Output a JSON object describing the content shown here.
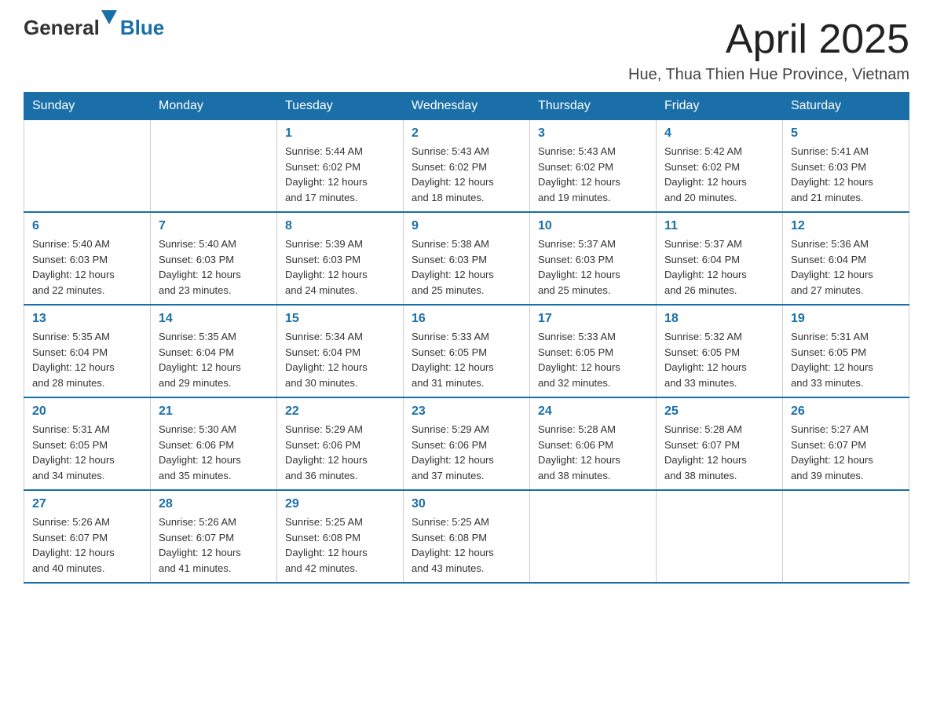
{
  "header": {
    "logo": {
      "general": "General",
      "blue": "Blue"
    },
    "title": "April 2025",
    "subtitle": "Hue, Thua Thien Hue Province, Vietnam"
  },
  "days_of_week": [
    "Sunday",
    "Monday",
    "Tuesday",
    "Wednesday",
    "Thursday",
    "Friday",
    "Saturday"
  ],
  "weeks": [
    [
      {
        "day": "",
        "info": ""
      },
      {
        "day": "",
        "info": ""
      },
      {
        "day": "1",
        "info": "Sunrise: 5:44 AM\nSunset: 6:02 PM\nDaylight: 12 hours\nand 17 minutes."
      },
      {
        "day": "2",
        "info": "Sunrise: 5:43 AM\nSunset: 6:02 PM\nDaylight: 12 hours\nand 18 minutes."
      },
      {
        "day": "3",
        "info": "Sunrise: 5:43 AM\nSunset: 6:02 PM\nDaylight: 12 hours\nand 19 minutes."
      },
      {
        "day": "4",
        "info": "Sunrise: 5:42 AM\nSunset: 6:02 PM\nDaylight: 12 hours\nand 20 minutes."
      },
      {
        "day": "5",
        "info": "Sunrise: 5:41 AM\nSunset: 6:03 PM\nDaylight: 12 hours\nand 21 minutes."
      }
    ],
    [
      {
        "day": "6",
        "info": "Sunrise: 5:40 AM\nSunset: 6:03 PM\nDaylight: 12 hours\nand 22 minutes."
      },
      {
        "day": "7",
        "info": "Sunrise: 5:40 AM\nSunset: 6:03 PM\nDaylight: 12 hours\nand 23 minutes."
      },
      {
        "day": "8",
        "info": "Sunrise: 5:39 AM\nSunset: 6:03 PM\nDaylight: 12 hours\nand 24 minutes."
      },
      {
        "day": "9",
        "info": "Sunrise: 5:38 AM\nSunset: 6:03 PM\nDaylight: 12 hours\nand 25 minutes."
      },
      {
        "day": "10",
        "info": "Sunrise: 5:37 AM\nSunset: 6:03 PM\nDaylight: 12 hours\nand 25 minutes."
      },
      {
        "day": "11",
        "info": "Sunrise: 5:37 AM\nSunset: 6:04 PM\nDaylight: 12 hours\nand 26 minutes."
      },
      {
        "day": "12",
        "info": "Sunrise: 5:36 AM\nSunset: 6:04 PM\nDaylight: 12 hours\nand 27 minutes."
      }
    ],
    [
      {
        "day": "13",
        "info": "Sunrise: 5:35 AM\nSunset: 6:04 PM\nDaylight: 12 hours\nand 28 minutes."
      },
      {
        "day": "14",
        "info": "Sunrise: 5:35 AM\nSunset: 6:04 PM\nDaylight: 12 hours\nand 29 minutes."
      },
      {
        "day": "15",
        "info": "Sunrise: 5:34 AM\nSunset: 6:04 PM\nDaylight: 12 hours\nand 30 minutes."
      },
      {
        "day": "16",
        "info": "Sunrise: 5:33 AM\nSunset: 6:05 PM\nDaylight: 12 hours\nand 31 minutes."
      },
      {
        "day": "17",
        "info": "Sunrise: 5:33 AM\nSunset: 6:05 PM\nDaylight: 12 hours\nand 32 minutes."
      },
      {
        "day": "18",
        "info": "Sunrise: 5:32 AM\nSunset: 6:05 PM\nDaylight: 12 hours\nand 33 minutes."
      },
      {
        "day": "19",
        "info": "Sunrise: 5:31 AM\nSunset: 6:05 PM\nDaylight: 12 hours\nand 33 minutes."
      }
    ],
    [
      {
        "day": "20",
        "info": "Sunrise: 5:31 AM\nSunset: 6:05 PM\nDaylight: 12 hours\nand 34 minutes."
      },
      {
        "day": "21",
        "info": "Sunrise: 5:30 AM\nSunset: 6:06 PM\nDaylight: 12 hours\nand 35 minutes."
      },
      {
        "day": "22",
        "info": "Sunrise: 5:29 AM\nSunset: 6:06 PM\nDaylight: 12 hours\nand 36 minutes."
      },
      {
        "day": "23",
        "info": "Sunrise: 5:29 AM\nSunset: 6:06 PM\nDaylight: 12 hours\nand 37 minutes."
      },
      {
        "day": "24",
        "info": "Sunrise: 5:28 AM\nSunset: 6:06 PM\nDaylight: 12 hours\nand 38 minutes."
      },
      {
        "day": "25",
        "info": "Sunrise: 5:28 AM\nSunset: 6:07 PM\nDaylight: 12 hours\nand 38 minutes."
      },
      {
        "day": "26",
        "info": "Sunrise: 5:27 AM\nSunset: 6:07 PM\nDaylight: 12 hours\nand 39 minutes."
      }
    ],
    [
      {
        "day": "27",
        "info": "Sunrise: 5:26 AM\nSunset: 6:07 PM\nDaylight: 12 hours\nand 40 minutes."
      },
      {
        "day": "28",
        "info": "Sunrise: 5:26 AM\nSunset: 6:07 PM\nDaylight: 12 hours\nand 41 minutes."
      },
      {
        "day": "29",
        "info": "Sunrise: 5:25 AM\nSunset: 6:08 PM\nDaylight: 12 hours\nand 42 minutes."
      },
      {
        "day": "30",
        "info": "Sunrise: 5:25 AM\nSunset: 6:08 PM\nDaylight: 12 hours\nand 43 minutes."
      },
      {
        "day": "",
        "info": ""
      },
      {
        "day": "",
        "info": ""
      },
      {
        "day": "",
        "info": ""
      }
    ]
  ]
}
